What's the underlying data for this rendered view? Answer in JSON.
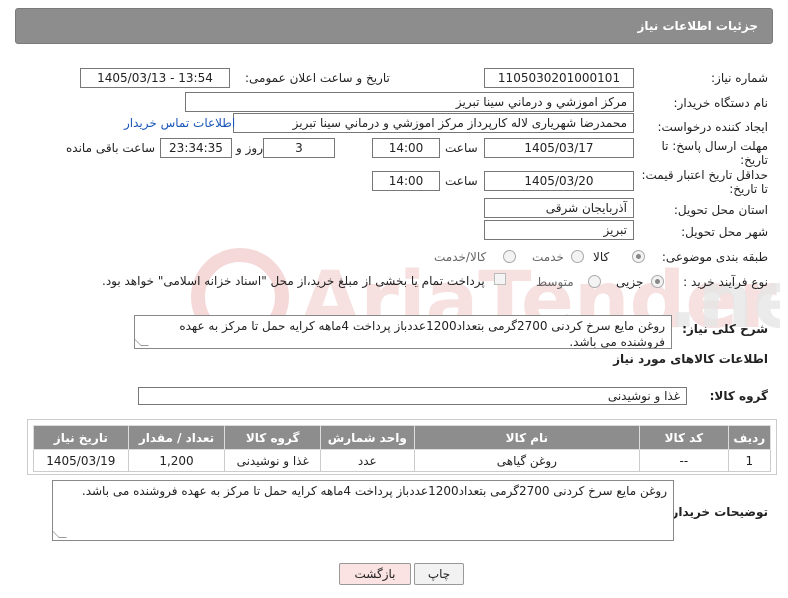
{
  "header": {
    "title": "جزئیات اطلاعات نیاز"
  },
  "form": {
    "need_number_label": "شماره نیاز:",
    "need_number": "1105030201000101",
    "announce_label": "تاریخ و ساعت اعلان عمومی:",
    "announce_value": "1405/03/13 - 13:54",
    "buyer_org_label": "نام دستگاه خریدار:",
    "buyer_org": "مرکز اموزشي و درماني سينا تبريز",
    "requester_label": "ایجاد کننده درخواست:",
    "requester": "محمدرضا شهریاری لاله کارپرداز مرکز اموزشي و درماني سينا تبريز",
    "contact_link": "اطلاعات تماس خریدار",
    "reply_deadline_label_1": "مهلت ارسال پاسخ: تا",
    "reply_deadline_label_2": "تاریخ:",
    "reply_date": "1405/03/17",
    "time_label": "ساعت",
    "reply_time": "14:00",
    "days_value": "3",
    "days_label": "روز و",
    "remaining_time": "23:34:35",
    "remaining_label": "ساعت باقی مانده",
    "price_deadline_label_1": "حداقل تاریخ اعتبار قیمت:",
    "price_deadline_label_2": "تا تاریخ:",
    "price_date": "1405/03/20",
    "price_time_label": "ساعت",
    "price_time": "14:00",
    "province_label": "استان محل تحویل:",
    "province": "آذربایجان شرقی",
    "city_label": "شهر محل تحویل:",
    "city": "تبریز",
    "category_label": "طبقه بندی موضوعی:",
    "category_options": [
      "کالا",
      "خدمت",
      "کالا/خدمت"
    ],
    "process_label": "نوع فرآیند خرید :",
    "process_options": [
      "جزیی",
      "متوسط"
    ],
    "payment_note": "پرداخت تمام یا بخشی از مبلغ خرید،از محل \"اسناد خزانه اسلامی\" خواهد بود."
  },
  "description": {
    "label": "شرح کلی نیاز:",
    "text": "روغن مایع سرخ کردنی 2700گرمی بتعداد1200عددباز پرداخت 4ماهه کرایه حمل تا مرکز به عهده فروشنده می باشد."
  },
  "goods": {
    "section_title": "اطلاعات کالاهای مورد نیاز",
    "group_label": "گروه کالا:",
    "group_value": "غذا و نوشیدنی",
    "columns": [
      "ردیف",
      "کد کالا",
      "نام کالا",
      "واحد شمارش",
      "گروه کالا",
      "تعداد / مقدار",
      "تاریخ نیاز"
    ],
    "rows": [
      [
        "1",
        "--",
        "روغن گیاهی",
        "عدد",
        "غذا و نوشیدنی",
        "1,200",
        "1405/03/19"
      ]
    ]
  },
  "buyer_notes": {
    "label": "توضیحات خریدار:",
    "text": "روغن مایع سرخ کردنی 2700گرمی بتعداد1200عددباز پرداخت 4ماهه کرایه حمل تا مرکز به عهده فروشنده می باشد."
  },
  "buttons": {
    "print": "چاپ",
    "back": "بازگشت"
  },
  "colors": {
    "header_bg": "#8d8d8d",
    "back_bg": "#fbe3e3",
    "link": "#1a56b8"
  }
}
